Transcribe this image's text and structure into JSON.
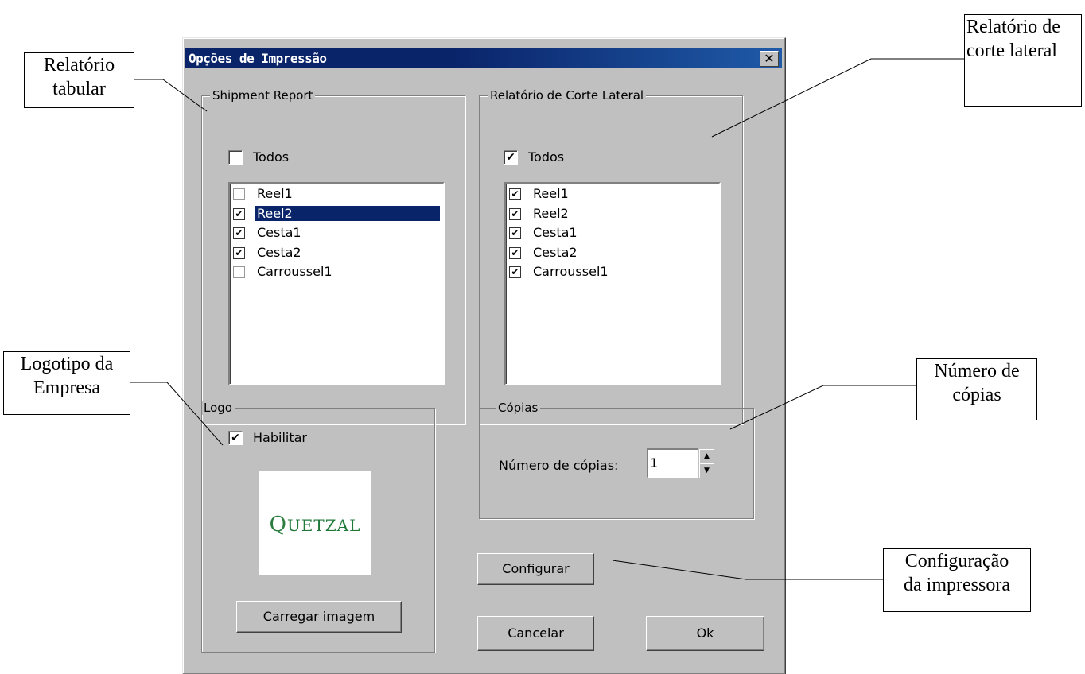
{
  "dialog": {
    "title": "Opções de Impressão",
    "close_glyph": "✕"
  },
  "shipment_report": {
    "legend": "Shipment Report",
    "all_label": "Todos",
    "all_checked": false,
    "items": [
      {
        "label": "Reel1",
        "checked": false,
        "selected": false
      },
      {
        "label": "Reel2",
        "checked": true,
        "selected": true
      },
      {
        "label": "Cesta1",
        "checked": true,
        "selected": false
      },
      {
        "label": "Cesta2",
        "checked": true,
        "selected": false
      },
      {
        "label": "Carroussel1",
        "checked": false,
        "selected": false
      }
    ]
  },
  "side_cut_report": {
    "legend": "Relatório de Corte Lateral",
    "all_label": "Todos",
    "all_checked": true,
    "items": [
      {
        "label": "Reel1",
        "checked": true
      },
      {
        "label": "Reel2",
        "checked": true
      },
      {
        "label": "Cesta1",
        "checked": true
      },
      {
        "label": "Cesta2",
        "checked": true
      },
      {
        "label": "Carroussel1",
        "checked": true
      }
    ]
  },
  "logo": {
    "legend": "Logo",
    "enable_label": "Habilitar",
    "enable_checked": true,
    "image_text_first": "Q",
    "image_text_rest": "UETZAL",
    "load_button": "Carregar imagem"
  },
  "copies": {
    "legend": "Cópias",
    "label": "Número de cópias:",
    "value": "1"
  },
  "buttons": {
    "configure": "Configurar",
    "cancel": "Cancelar",
    "ok": "Ok"
  },
  "callouts": {
    "tabular_line1": "Relatório",
    "tabular_line2": "tabular",
    "side_line1": "Relatório de",
    "side_line2": "corte lateral",
    "logo_line1": "Logotipo da",
    "logo_line2": "Empresa",
    "copies_line1": "Número de",
    "copies_line2": "cópias",
    "printer_line1": "Configuração",
    "printer_line2": "da impressora"
  },
  "colors": {
    "titlebar": "#0a246a",
    "dialog_face": "#c0c0c0",
    "selection": "#0a246a",
    "logo_green": "#2a7d3e"
  }
}
